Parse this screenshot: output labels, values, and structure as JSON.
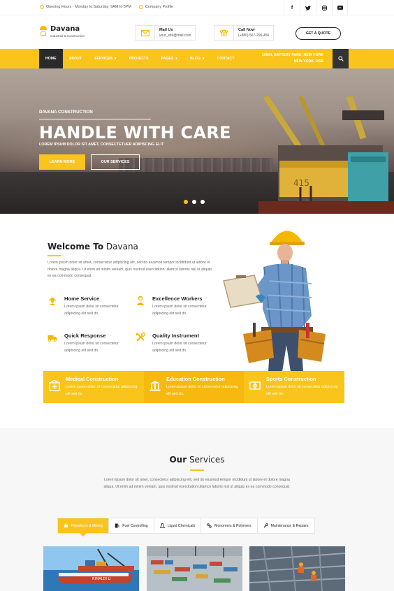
{
  "topbar": {
    "hours": "Opening Hours - Monday to Saturday: 9AM to 5PM",
    "profile": "Company Profile",
    "social": [
      "f",
      "t",
      "ig",
      "yt"
    ]
  },
  "brand": {
    "name": "Davana",
    "tagline": "Industrial & Construction"
  },
  "contact": {
    "mail_label": "Mail Us",
    "mail_value": "your_site@mail.com",
    "call_label": "Call Now",
    "call_value": "(+880) 567-290-456"
  },
  "quote_button": "GET A QUOTE",
  "nav": {
    "items": [
      {
        "label": "HOME",
        "caret": ""
      },
      {
        "label": "ABOUT",
        "caret": ""
      },
      {
        "label": "SERVICES",
        "caret": "▾"
      },
      {
        "label": "PROJECTS",
        "caret": ""
      },
      {
        "label": "PAGES",
        "caret": "▾"
      },
      {
        "label": "BLOG",
        "caret": "▾"
      },
      {
        "label": "CONTACT",
        "caret": ""
      }
    ],
    "address_line1": "10004, BATTERY PARK, NEW YORK",
    "address_line2": "NEW YORK, USA"
  },
  "hero": {
    "eyebrow": "DAVANA CONSTRUCTION",
    "title": "HANDLE WITH CARE",
    "subtitle": "LOREM IPSUM DOLOR SIT AMET, CONSECTETUER ADIPISCING ELIT",
    "learn_more": "LEARN MORE",
    "our_services": "OUR SERVICES",
    "ship_label": "415"
  },
  "welcome": {
    "title_bold": "Welcome To",
    "title_rest": " Davana",
    "paragraph": "Lorem ipsum dolor sit amet, consectetur adipiscing elit, sed do eiusmod tempor incididunt ut labore et dolore magna aliqua. Ut enim ad minim veniam, quis nostrud exercitation ullamco laboris nisi ut aliquip ex ea commodo consequat.",
    "features": [
      {
        "title": "Home Service",
        "text": "Lorem ipsum dolor sit consectetur adipiscing elit sed do."
      },
      {
        "title": "Excellence Workers",
        "text": "Lorem ipsum dolor sit consectetur adipiscing elit sed do."
      },
      {
        "title": "Quick Response",
        "text": "Lorem ipsum dolor sit consectetur adipiscing elit sed do."
      },
      {
        "title": "Quality Instrument",
        "text": "Lorem ipsum dolor sit consectetur adipiscing elit sed do."
      }
    ]
  },
  "strip": [
    {
      "title": "Medical Construction",
      "text": "Lorem ipsum dolor sit consectetur adipiscing elit sed do."
    },
    {
      "title": "Education Construction",
      "text": "Lorem ipsum dolor sit consectetur adipiscing elit sed do."
    },
    {
      "title": "Sports Construction",
      "text": "Lorem ipsum dolor sit consectetur adipiscing elit sed do."
    }
  ],
  "services": {
    "title_bold": "Our",
    "title_rest": " Services",
    "description": "Lorem ipsum dolor sit amet, consectetur adipiscing elit, sed do eiusmod tempor incididunt ut labore et dolore magna aliqua. Ut enim ad minim veniam, quis nostrud exercitation ullamco laboris nisi ut aliquip ex ea commodo consequat.",
    "tabs": [
      {
        "label": "Petroleum & Mining",
        "icon": "fuel-drop-icon",
        "active": true
      },
      {
        "label": "Fuel Controlling",
        "icon": "fuel-pump-icon",
        "active": false
      },
      {
        "label": "Liquid Chemicals",
        "icon": "flask-icon",
        "active": false
      },
      {
        "label": "Monomers & Polymers",
        "icon": "molecule-icon",
        "active": false
      },
      {
        "label": "Maintenance & Repairs",
        "icon": "wrench-icon",
        "active": false
      }
    ],
    "card1_ship_text": "RIMALDI LI"
  },
  "colors": {
    "accent": "#f9c41b",
    "dark": "#2a2a2a"
  }
}
